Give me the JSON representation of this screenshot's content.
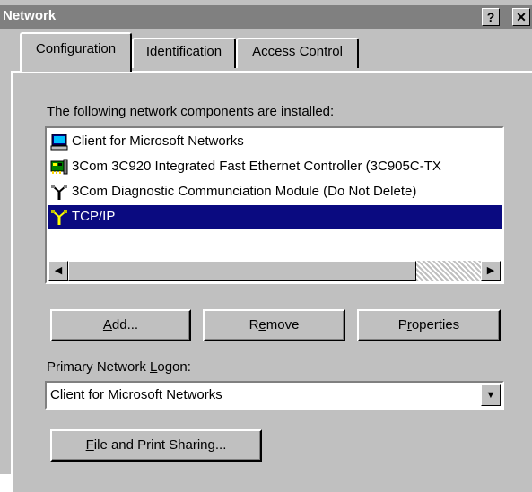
{
  "window": {
    "title": "Network",
    "help_button": "?",
    "close_button": "✕"
  },
  "tabs": [
    {
      "label": "Configuration"
    },
    {
      "label": "Identification"
    },
    {
      "label": "Access Control"
    }
  ],
  "components": {
    "label_prefix": "The following ",
    "label_mnemonic": "n",
    "label_suffix": "etwork components are installed:",
    "items": [
      {
        "icon": "client-icon",
        "label": "Client for Microsoft Networks"
      },
      {
        "icon": "network-adapter-icon",
        "label": "3Com 3C920 Integrated Fast Ethernet Controller (3C905C-TX"
      },
      {
        "icon": "protocol-icon",
        "label": "3Com Diagnostic Communciation Module (Do Not Delete)"
      },
      {
        "icon": "protocol-icon",
        "label": "TCP/IP",
        "selected": true
      }
    ]
  },
  "buttons": {
    "add_mn": "A",
    "add_rest": "dd...",
    "remove_a": "R",
    "remove_mn": "e",
    "remove_b": "move",
    "properties_a": "P",
    "properties_mn": "r",
    "properties_b": "operties"
  },
  "logon": {
    "label_a": "Primary Network ",
    "label_mn": "L",
    "label_b": "ogon:",
    "value": "Client for Microsoft Networks"
  },
  "sharing": {
    "mn": "F",
    "rest": "ile and Print Sharing..."
  }
}
